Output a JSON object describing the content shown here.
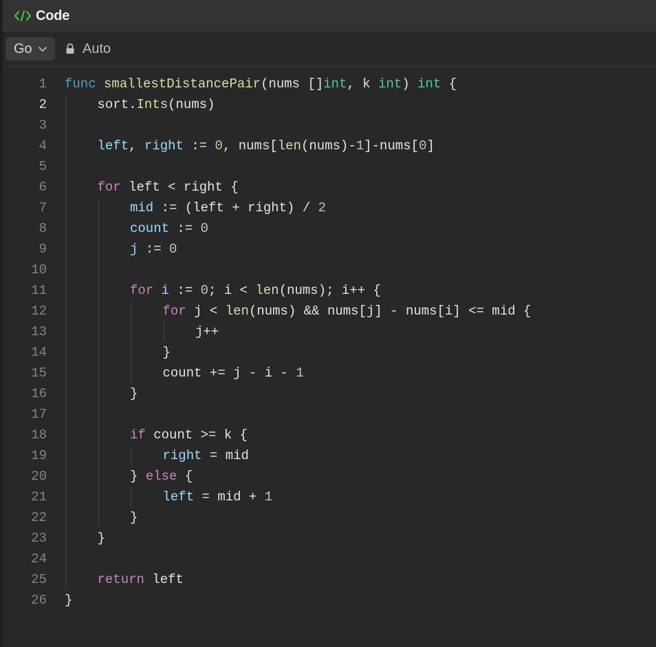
{
  "header": {
    "title": "Code",
    "icon": "code-brackets-icon",
    "accent": "#4ec94e"
  },
  "toolbar": {
    "language": "Go",
    "mode": "Auto"
  },
  "editor": {
    "active_line": 2,
    "lines": [
      {
        "n": "1",
        "indent": 0,
        "tokens": [
          {
            "t": "func",
            "c": "kwb"
          },
          {
            "t": " ",
            "c": "tx"
          },
          {
            "t": "smallestDistancePair",
            "c": "fn"
          },
          {
            "t": "(nums []",
            "c": "tx"
          },
          {
            "t": "int",
            "c": "ty"
          },
          {
            "t": ", k ",
            "c": "tx"
          },
          {
            "t": "int",
            "c": "ty"
          },
          {
            "t": ") ",
            "c": "tx"
          },
          {
            "t": "int",
            "c": "ty"
          },
          {
            "t": " {",
            "c": "tx"
          }
        ]
      },
      {
        "n": "2",
        "indent": 1,
        "tokens": [
          {
            "t": "sort.",
            "c": "tx"
          },
          {
            "t": "Ints",
            "c": "fn"
          },
          {
            "t": "(nums)",
            "c": "tx"
          }
        ]
      },
      {
        "n": "3",
        "indent": 0,
        "tokens": []
      },
      {
        "n": "4",
        "indent": 1,
        "tokens": [
          {
            "t": "left",
            "c": "vr"
          },
          {
            "t": ", ",
            "c": "tx"
          },
          {
            "t": "right",
            "c": "vr"
          },
          {
            "t": " := ",
            "c": "tx"
          },
          {
            "t": "0",
            "c": "nm"
          },
          {
            "t": ", nums[",
            "c": "tx"
          },
          {
            "t": "len",
            "c": "fn"
          },
          {
            "t": "(nums)-",
            "c": "tx"
          },
          {
            "t": "1",
            "c": "nm"
          },
          {
            "t": "]-nums[",
            "c": "tx"
          },
          {
            "t": "0",
            "c": "nm"
          },
          {
            "t": "]",
            "c": "tx"
          }
        ]
      },
      {
        "n": "5",
        "indent": 0,
        "tokens": []
      },
      {
        "n": "6",
        "indent": 1,
        "tokens": [
          {
            "t": "for",
            "c": "kw"
          },
          {
            "t": " left < right {",
            "c": "tx"
          }
        ]
      },
      {
        "n": "7",
        "indent": 2,
        "tokens": [
          {
            "t": "mid",
            "c": "vr"
          },
          {
            "t": " := (left + right) / ",
            "c": "tx"
          },
          {
            "t": "2",
            "c": "nm"
          }
        ]
      },
      {
        "n": "8",
        "indent": 2,
        "tokens": [
          {
            "t": "count",
            "c": "vr"
          },
          {
            "t": " := ",
            "c": "tx"
          },
          {
            "t": "0",
            "c": "nm"
          }
        ]
      },
      {
        "n": "9",
        "indent": 2,
        "tokens": [
          {
            "t": "j",
            "c": "vr"
          },
          {
            "t": " := ",
            "c": "tx"
          },
          {
            "t": "0",
            "c": "nm"
          }
        ]
      },
      {
        "n": "10",
        "indent": 0,
        "tokens": []
      },
      {
        "n": "11",
        "indent": 2,
        "tokens": [
          {
            "t": "for",
            "c": "kw"
          },
          {
            "t": " ",
            "c": "tx"
          },
          {
            "t": "i",
            "c": "vr"
          },
          {
            "t": " := ",
            "c": "tx"
          },
          {
            "t": "0",
            "c": "nm"
          },
          {
            "t": "; i < ",
            "c": "tx"
          },
          {
            "t": "len",
            "c": "fn"
          },
          {
            "t": "(nums); i++ {",
            "c": "tx"
          }
        ]
      },
      {
        "n": "12",
        "indent": 3,
        "tokens": [
          {
            "t": "for",
            "c": "kw"
          },
          {
            "t": " j < ",
            "c": "tx"
          },
          {
            "t": "len",
            "c": "fn"
          },
          {
            "t": "(nums) && nums[j] - nums[i] <= mid {",
            "c": "tx"
          }
        ]
      },
      {
        "n": "13",
        "indent": 4,
        "tokens": [
          {
            "t": "j++",
            "c": "tx"
          }
        ]
      },
      {
        "n": "14",
        "indent": 3,
        "tokens": [
          {
            "t": "}",
            "c": "tx"
          }
        ]
      },
      {
        "n": "15",
        "indent": 3,
        "tokens": [
          {
            "t": "count += j - i - ",
            "c": "tx"
          },
          {
            "t": "1",
            "c": "nm"
          }
        ]
      },
      {
        "n": "16",
        "indent": 2,
        "tokens": [
          {
            "t": "}",
            "c": "tx"
          }
        ]
      },
      {
        "n": "17",
        "indent": 0,
        "tokens": []
      },
      {
        "n": "18",
        "indent": 2,
        "tokens": [
          {
            "t": "if",
            "c": "kw"
          },
          {
            "t": " count >= k {",
            "c": "tx"
          }
        ]
      },
      {
        "n": "19",
        "indent": 3,
        "tokens": [
          {
            "t": "right",
            "c": "vr"
          },
          {
            "t": " = mid",
            "c": "tx"
          }
        ]
      },
      {
        "n": "20",
        "indent": 2,
        "tokens": [
          {
            "t": "} ",
            "c": "tx"
          },
          {
            "t": "else",
            "c": "kw"
          },
          {
            "t": " {",
            "c": "tx"
          }
        ]
      },
      {
        "n": "21",
        "indent": 3,
        "tokens": [
          {
            "t": "left",
            "c": "vr"
          },
          {
            "t": " = mid + ",
            "c": "tx"
          },
          {
            "t": "1",
            "c": "nm"
          }
        ]
      },
      {
        "n": "22",
        "indent": 2,
        "tokens": [
          {
            "t": "}",
            "c": "tx"
          }
        ]
      },
      {
        "n": "23",
        "indent": 1,
        "tokens": [
          {
            "t": "}",
            "c": "tx"
          }
        ]
      },
      {
        "n": "24",
        "indent": 0,
        "tokens": []
      },
      {
        "n": "25",
        "indent": 1,
        "tokens": [
          {
            "t": "return",
            "c": "kw"
          },
          {
            "t": " left",
            "c": "tx"
          }
        ]
      },
      {
        "n": "26",
        "indent": 0,
        "tokens": [
          {
            "t": "}",
            "c": "tx"
          }
        ]
      }
    ]
  }
}
